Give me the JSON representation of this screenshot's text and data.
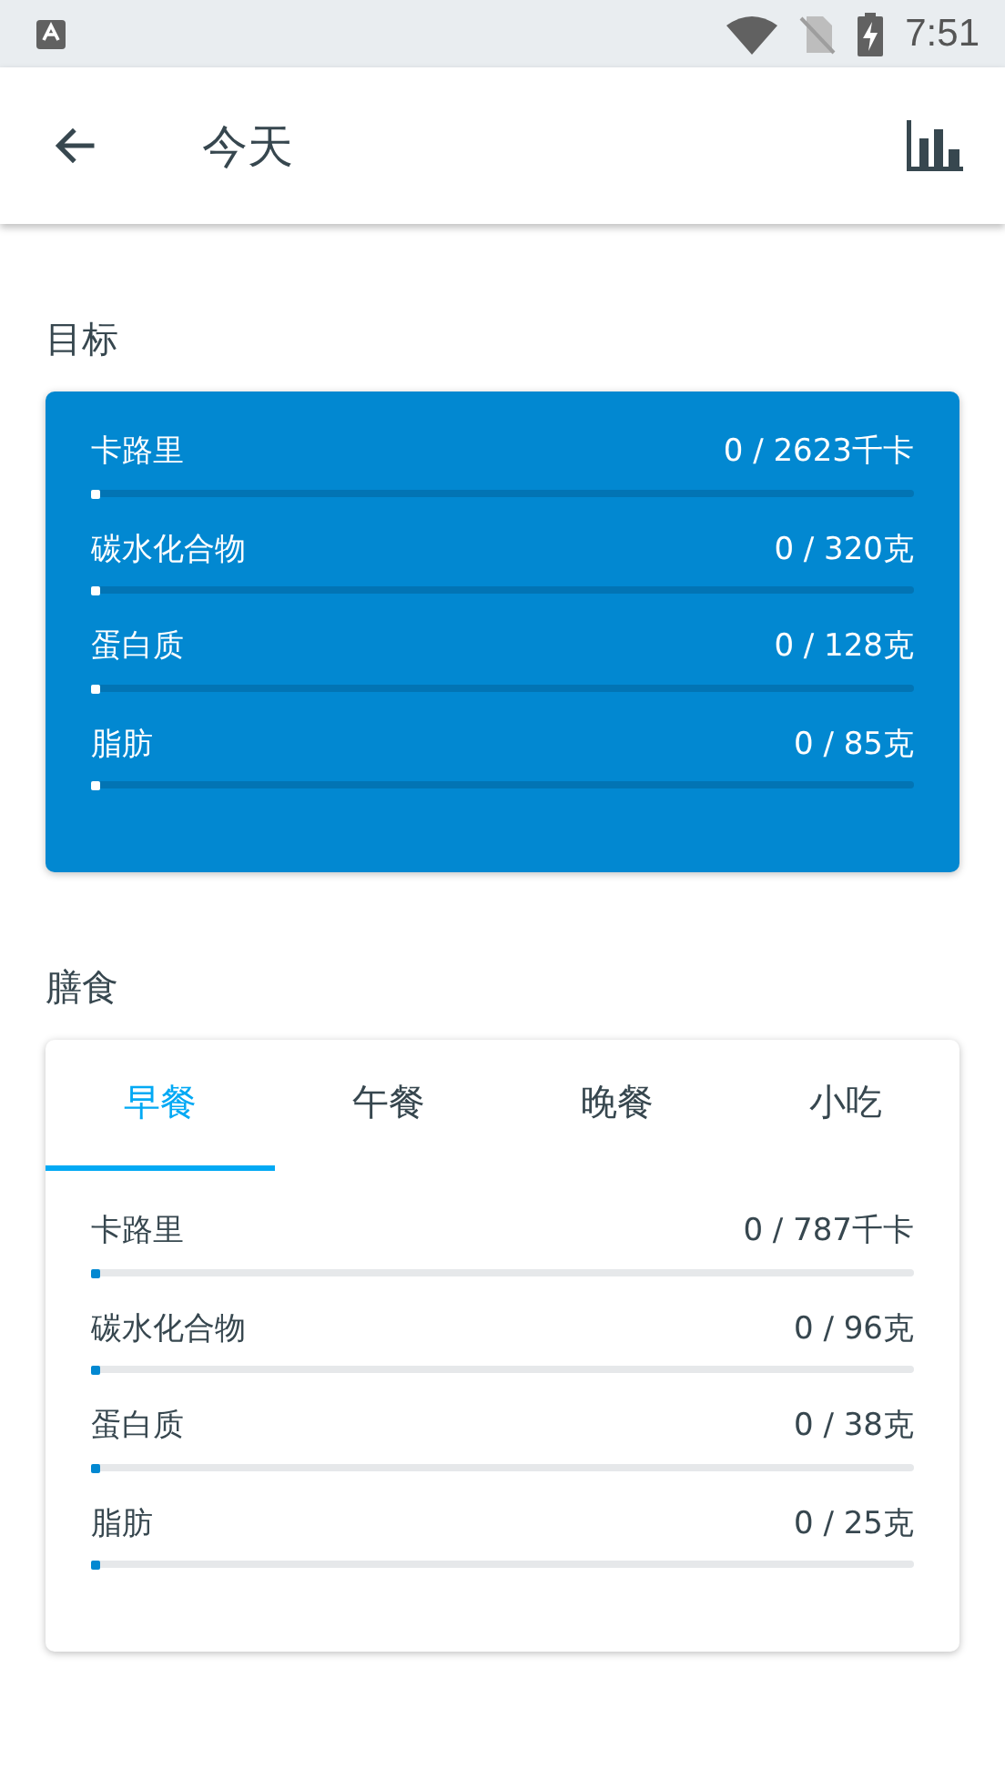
{
  "status_bar": {
    "time": "7:51"
  },
  "app_bar": {
    "title": "今天"
  },
  "goals": {
    "heading": "目标",
    "rows": [
      {
        "name": "卡路里",
        "reading": "0 / 2623千卡",
        "level": 0
      },
      {
        "name": "碳水化合物",
        "reading": "0 / 320克",
        "level": 0
      },
      {
        "name": "蛋白质",
        "reading": "0 / 128克",
        "level": 0
      },
      {
        "name": "脂肪",
        "reading": "0 / 85克",
        "level": 0
      }
    ]
  },
  "meals": {
    "heading": "膳食",
    "tabs": [
      {
        "label": "早餐",
        "selected": true
      },
      {
        "label": "午餐",
        "selected": false
      },
      {
        "label": "晚餐",
        "selected": false
      },
      {
        "label": "小吃",
        "selected": false
      }
    ],
    "rows": [
      {
        "name": "卡路里",
        "reading": "0 / 787千卡",
        "level": 0
      },
      {
        "name": "碳水化合物",
        "reading": "0 / 96克",
        "level": 0
      },
      {
        "name": "蛋白质",
        "reading": "0 / 38克",
        "level": 0
      },
      {
        "name": "脂肪",
        "reading": "0 / 25克",
        "level": 0
      }
    ]
  }
}
